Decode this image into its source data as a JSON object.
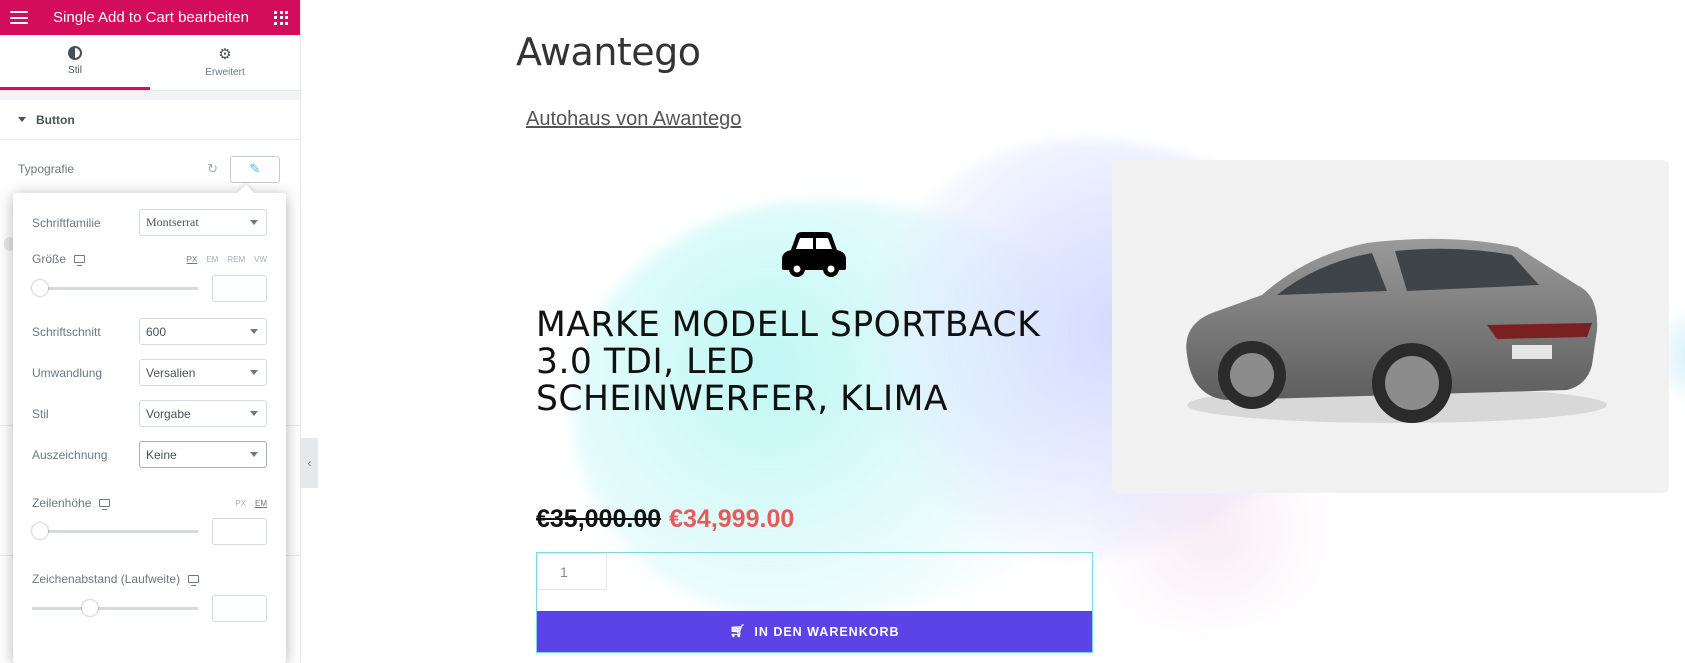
{
  "panel": {
    "title": "Single Add to Cart bearbeiten",
    "tabs": [
      {
        "label": "Stil",
        "icon": "half-circle-icon",
        "active": true
      },
      {
        "label": "Erweitert",
        "icon": "gear-icon",
        "active": false
      }
    ],
    "section": "Button",
    "typography_label": "Typografie",
    "popover": {
      "font_family_label": "Schriftfamilie",
      "font_family_value": "Montserrat",
      "size_label": "Größe",
      "size_units": [
        "PX",
        "EM",
        "REM",
        "VW"
      ],
      "size_unit_active": "PX",
      "size_slider": 0,
      "weight_label": "Schriftschnitt",
      "weight_value": "600",
      "transform_label": "Umwandlung",
      "transform_value": "Versalien",
      "style_label": "Stil",
      "style_value": "Vorgabe",
      "decoration_label": "Auszeichnung",
      "decoration_value": "Keine",
      "line_height_label": "Zeilenhöhe",
      "line_height_units": [
        "PX",
        "EM"
      ],
      "line_height_unit_active": "EM",
      "line_height_slider": 0,
      "letter_spacing_label": "Zeichenabstand (Laufweite)",
      "letter_spacing_slider": 0.33
    },
    "accent_color": "#d30c5c"
  },
  "preview": {
    "site_title": "Awantego",
    "tagline": "Autohaus von Awantego",
    "product_title": "Marke Modell Sportback 3.0 TDI, LED Scheinwerfer, Klima",
    "price_old": "€35,000.00",
    "price_new": "€34,999.00",
    "quantity": "1",
    "add_to_cart_label": "IN DEN WARENKORB",
    "button_color": "#5c43e8",
    "sale_price_color": "#e65a5a"
  }
}
